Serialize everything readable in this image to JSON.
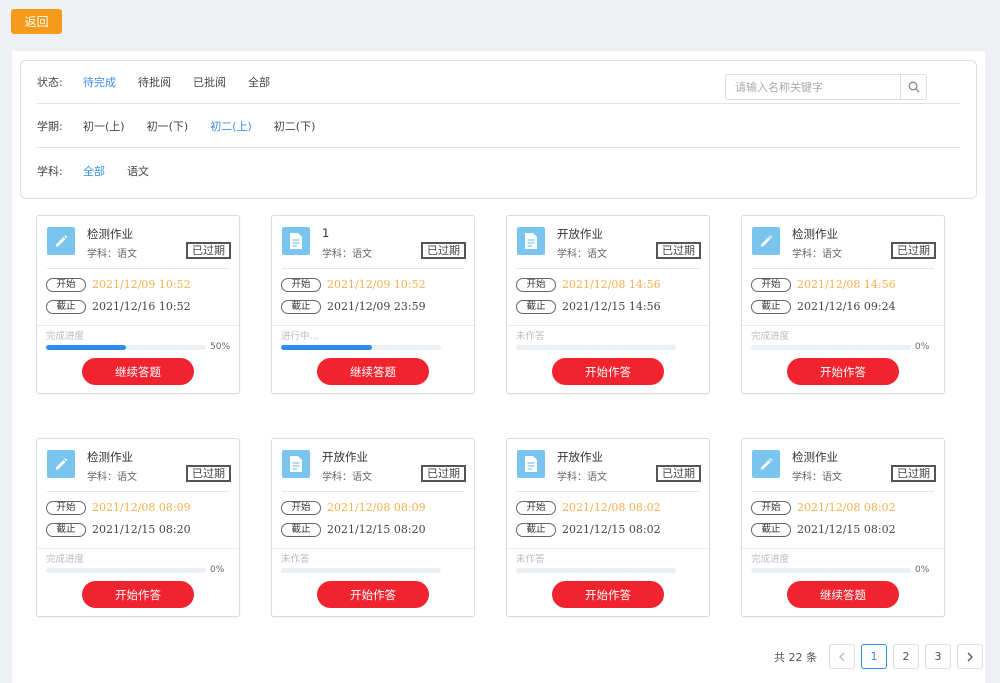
{
  "back_label": "返回",
  "filters": {
    "status": {
      "label": "状态:",
      "options": [
        "待完成",
        "待批阅",
        "已批阅",
        "全部"
      ],
      "active": 0
    },
    "term": {
      "label": "学期:",
      "options": [
        "初一(上)",
        "初一(下)",
        "初二(上)",
        "初二(下)"
      ],
      "active": 2
    },
    "subject": {
      "label": "学科:",
      "options": [
        "全部",
        "语文"
      ],
      "active": 0
    }
  },
  "search": {
    "placeholder": "请输入名称关键字",
    "icon": "search-icon"
  },
  "card_labels": {
    "expired": "已过期",
    "start": "开始",
    "end": "截止"
  },
  "cards": [
    {
      "icon": "pencil-icon",
      "title": "检测作业",
      "subject": "学科：语文",
      "start": "2021/12/09 10:52",
      "end": "2021/12/16 10:52",
      "progress_label": "完成进度",
      "progress": 50,
      "percent": "50%",
      "button": "继续答题"
    },
    {
      "icon": "document-icon",
      "title": "1",
      "subject": "学科：语文",
      "start": "2021/12/09 10:52",
      "end": "2021/12/09 23:59",
      "progress_label": "进行中...",
      "progress": 57,
      "percent": "",
      "button": "继续答题"
    },
    {
      "icon": "document-icon",
      "title": "开放作业",
      "subject": "学科：语文",
      "start": "2021/12/08 14:56",
      "end": "2021/12/15 14:56",
      "progress_label": "未作答",
      "progress": 0,
      "percent": "",
      "button": "开始作答"
    },
    {
      "icon": "pencil-icon",
      "title": "检测作业",
      "subject": "学科：语文",
      "start": "2021/12/08 14:56",
      "end": "2021/12/16 09:24",
      "progress_label": "完成进度",
      "progress": 0,
      "percent": "0%",
      "button": "开始作答"
    },
    {
      "icon": "pencil-icon",
      "title": "检测作业",
      "subject": "学科：语文",
      "start": "2021/12/08 08:09",
      "end": "2021/12/15 08:20",
      "progress_label": "完成进度",
      "progress": 0,
      "percent": "0%",
      "button": "开始作答"
    },
    {
      "icon": "document-icon",
      "title": "开放作业",
      "subject": "学科：语文",
      "start": "2021/12/08 08:09",
      "end": "2021/12/15 08:20",
      "progress_label": "未作答",
      "progress": 0,
      "percent": "",
      "button": "开始作答"
    },
    {
      "icon": "document-icon",
      "title": "开放作业",
      "subject": "学科：语文",
      "start": "2021/12/08 08:02",
      "end": "2021/12/15 08:02",
      "progress_label": "未作答",
      "progress": 0,
      "percent": "",
      "button": "开始作答"
    },
    {
      "icon": "pencil-icon",
      "title": "检测作业",
      "subject": "学科：语文",
      "start": "2021/12/08 08:02",
      "end": "2021/12/15 08:02",
      "progress_label": "完成进度",
      "progress": 0,
      "percent": "0%",
      "button": "继续答题"
    }
  ],
  "pagination": {
    "total": "共 22 条",
    "pages": [
      "1",
      "2",
      "3"
    ],
    "current": 0,
    "prev": "prev-icon",
    "next": "next-icon"
  },
  "colors": {
    "accent": "#2d8cf0",
    "button": "#f0232f",
    "back": "#f59a1b",
    "start_time": "#f5b14f",
    "icon_bg": "#79c5f0"
  }
}
